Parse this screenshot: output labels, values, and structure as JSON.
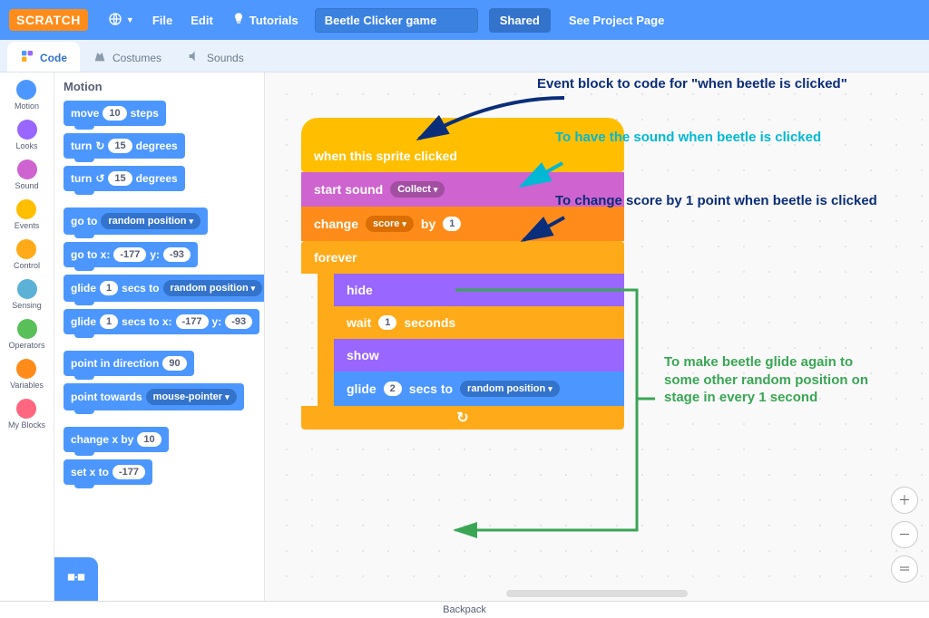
{
  "topbar": {
    "logo": "SCRATCH",
    "file": "File",
    "edit": "Edit",
    "tutorials": "Tutorials",
    "project_title": "Beetle Clicker game",
    "shared": "Shared",
    "see_project": "See Project Page"
  },
  "tabs": {
    "code": "Code",
    "costumes": "Costumes",
    "sounds": "Sounds"
  },
  "categories": [
    {
      "name": "Motion",
      "color": "#4c97ff"
    },
    {
      "name": "Looks",
      "color": "#9966ff"
    },
    {
      "name": "Sound",
      "color": "#cf63cf"
    },
    {
      "name": "Events",
      "color": "#ffbf00"
    },
    {
      "name": "Control",
      "color": "#ffab19"
    },
    {
      "name": "Sensing",
      "color": "#5cb1d6"
    },
    {
      "name": "Operators",
      "color": "#59c059"
    },
    {
      "name": "Variables",
      "color": "#ff8c1a"
    },
    {
      "name": "My Blocks",
      "color": "#ff6680"
    }
  ],
  "palette": {
    "header": "Motion",
    "blocks": {
      "move_steps_pre": "move",
      "move_steps_val": "10",
      "move_steps_post": "steps",
      "turn_cw_pre": "turn",
      "turn_cw_val": "15",
      "turn_cw_post": "degrees",
      "turn_ccw_pre": "turn",
      "turn_ccw_val": "15",
      "turn_ccw_post": "degrees",
      "goto_pre": "go to",
      "goto_dd": "random position",
      "gotoxy_pre": "go to x:",
      "gotoxy_x": "-177",
      "gotoxy_mid": "y:",
      "gotoxy_y": "-93",
      "glide_pre": "glide",
      "glide_secs": "1",
      "glide_mid": "secs to",
      "glide_dd": "random position",
      "glidexy_pre": "glide",
      "glidexy_secs": "1",
      "glidexy_mid": "secs to x:",
      "glidexy_x": "-177",
      "glidexy_mid2": "y:",
      "glidexy_y": "-93",
      "point_dir_pre": "point in direction",
      "point_dir_val": "90",
      "point_tw_pre": "point towards",
      "point_tw_dd": "mouse-pointer",
      "changex_pre": "change x by",
      "changex_val": "10",
      "setx_pre": "set x to",
      "setx_val": "-177"
    }
  },
  "script": {
    "hat": "when this sprite clicked",
    "sound_pre": "start sound",
    "sound_dd": "Collect",
    "change_pre": "change",
    "change_var": "score",
    "change_mid": "by",
    "change_val": "1",
    "forever": "forever",
    "hide": "hide",
    "wait_pre": "wait",
    "wait_val": "1",
    "wait_post": "seconds",
    "show": "show",
    "glide_pre": "glide",
    "glide_val": "2",
    "glide_mid": "secs to",
    "glide_dd": "random position"
  },
  "annotations": {
    "a1": "Event block to code for \"when beetle is clicked\"",
    "a2": "To have the sound when beetle is clicked",
    "a3": "To change score by 1 point when beetle is clicked",
    "a4": "To make beetle glide again to some other random position on stage in every 1 second"
  },
  "backpack": "Backpack"
}
